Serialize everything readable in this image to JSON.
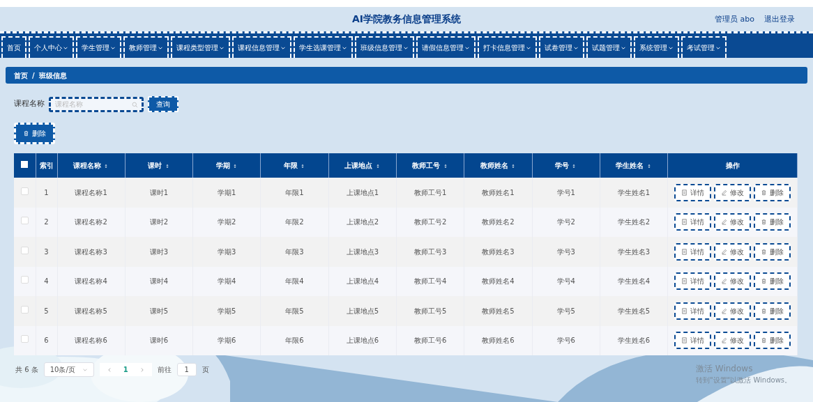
{
  "header": {
    "title": "AI学院教务信息管理系统",
    "user": "管理员 abo",
    "logout": "退出登录"
  },
  "nav": [
    {
      "label": "首页",
      "dropdown": false
    },
    {
      "label": "个人中心",
      "dropdown": true
    },
    {
      "label": "学生管理",
      "dropdown": true
    },
    {
      "label": "教师管理",
      "dropdown": true
    },
    {
      "label": "课程类型管理",
      "dropdown": true
    },
    {
      "label": "课程信息管理",
      "dropdown": true
    },
    {
      "label": "学生选课管理",
      "dropdown": true
    },
    {
      "label": "班级信息管理",
      "dropdown": true
    },
    {
      "label": "请假信息管理",
      "dropdown": true
    },
    {
      "label": "打卡信息管理",
      "dropdown": true
    },
    {
      "label": "试卷管理",
      "dropdown": true
    },
    {
      "label": "试题管理",
      "dropdown": true
    },
    {
      "label": "系统管理",
      "dropdown": true
    },
    {
      "label": "考试管理",
      "dropdown": true
    }
  ],
  "breadcrumb": [
    "首页",
    "班级信息"
  ],
  "breadcrumb_separator": "/",
  "search": {
    "label": "课程名称",
    "placeholder": "课程名称",
    "button": "查询"
  },
  "toolbar": {
    "delete": "删除"
  },
  "table": {
    "select_all_checked": false,
    "columns": [
      {
        "label": "索引",
        "sortable": false
      },
      {
        "label": "课程名称",
        "sortable": true
      },
      {
        "label": "课时",
        "sortable": true
      },
      {
        "label": "学期",
        "sortable": true
      },
      {
        "label": "年限",
        "sortable": true
      },
      {
        "label": "上课地点",
        "sortable": true
      },
      {
        "label": "教师工号",
        "sortable": true
      },
      {
        "label": "教师姓名",
        "sortable": true
      },
      {
        "label": "学号",
        "sortable": true
      },
      {
        "label": "学生姓名",
        "sortable": true
      },
      {
        "label": "操作",
        "sortable": false
      }
    ],
    "rows": [
      {
        "checked": false,
        "cells": [
          "1",
          "课程名称1",
          "课时1",
          "学期1",
          "年限1",
          "上课地点1",
          "教师工号1",
          "教师姓名1",
          "学号1",
          "学生姓名1"
        ],
        "actions": [
          {
            "kind": "detail",
            "label": "详情"
          },
          {
            "kind": "edit",
            "label": "修改"
          },
          {
            "kind": "delete",
            "label": "删除"
          }
        ]
      },
      {
        "checked": false,
        "cells": [
          "2",
          "课程名称2",
          "课时2",
          "学期2",
          "年限2",
          "上课地点2",
          "教师工号2",
          "教师姓名2",
          "学号2",
          "学生姓名2"
        ],
        "actions": [
          {
            "kind": "detail",
            "label": "详情"
          },
          {
            "kind": "edit",
            "label": "修改"
          },
          {
            "kind": "delete",
            "label": "删除"
          }
        ]
      },
      {
        "checked": false,
        "cells": [
          "3",
          "课程名称3",
          "课时3",
          "学期3",
          "年限3",
          "上课地点3",
          "教师工号3",
          "教师姓名3",
          "学号3",
          "学生姓名3"
        ],
        "actions": [
          {
            "kind": "detail",
            "label": "详情"
          },
          {
            "kind": "edit",
            "label": "修改"
          },
          {
            "kind": "delete",
            "label": "删除"
          }
        ]
      },
      {
        "checked": false,
        "cells": [
          "4",
          "课程名称4",
          "课时4",
          "学期4",
          "年限4",
          "上课地点4",
          "教师工号4",
          "教师姓名4",
          "学号4",
          "学生姓名4"
        ],
        "actions": [
          {
            "kind": "detail",
            "label": "详情"
          },
          {
            "kind": "edit",
            "label": "修改"
          },
          {
            "kind": "delete",
            "label": "删除"
          }
        ]
      },
      {
        "checked": false,
        "cells": [
          "5",
          "课程名称5",
          "课时5",
          "学期5",
          "年限5",
          "上课地点5",
          "教师工号5",
          "教师姓名5",
          "学号5",
          "学生姓名5"
        ],
        "actions": [
          {
            "kind": "detail",
            "label": "详情"
          },
          {
            "kind": "edit",
            "label": "修改"
          },
          {
            "kind": "delete",
            "label": "删除"
          }
        ]
      },
      {
        "checked": false,
        "cells": [
          "6",
          "课程名称6",
          "课时6",
          "学期6",
          "年限6",
          "上课地点6",
          "教师工号6",
          "教师姓名6",
          "学号6",
          "学生姓名6"
        ],
        "actions": [
          {
            "kind": "detail",
            "label": "详情"
          },
          {
            "kind": "edit",
            "label": "修改"
          },
          {
            "kind": "delete",
            "label": "删除"
          }
        ]
      }
    ]
  },
  "pagination": {
    "total": "共 6 条",
    "page_size": "10条/页",
    "pages": [
      {
        "label": "1",
        "selected": true
      }
    ],
    "goto_label": "前往",
    "goto_value": "1",
    "goto_suffix": "页"
  },
  "os_notice": {
    "title": "激活 Windows",
    "subtitle": "转到\"设置\"以激活 Windows。"
  }
}
